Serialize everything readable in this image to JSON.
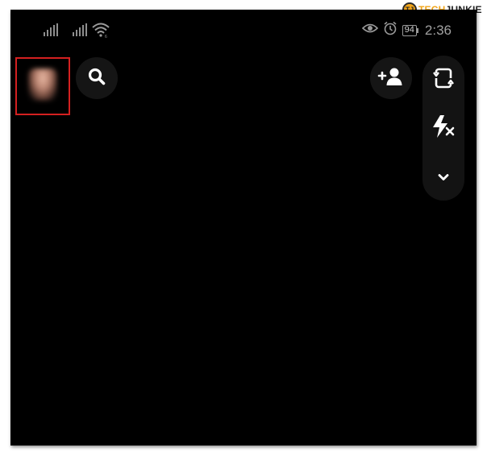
{
  "status_bar": {
    "battery_level": "94",
    "time": "2:36",
    "icons": [
      "signal-icon",
      "signal-icon",
      "wifi-icon",
      "eye-icon",
      "alarm-icon",
      "battery-icon"
    ]
  },
  "watermark": {
    "logo_text": "TJ",
    "brand_part1": "TECH",
    "brand_part2": "JUNKIE"
  },
  "top_bar": {
    "profile_avatar": "avatar",
    "search_icon": "search-icon",
    "add_friend_icon": "add-friend-icon"
  },
  "camera_controls": {
    "items": [
      "flip-camera-icon",
      "flash-off-icon",
      "chevron-down-icon"
    ]
  },
  "colors": {
    "background": "#000000",
    "highlight_box": "#d42020",
    "button_bg": "#151515",
    "icon": "#ffffff",
    "status_text": "#9a9a9a",
    "watermark_accent": "#f2a51a"
  }
}
